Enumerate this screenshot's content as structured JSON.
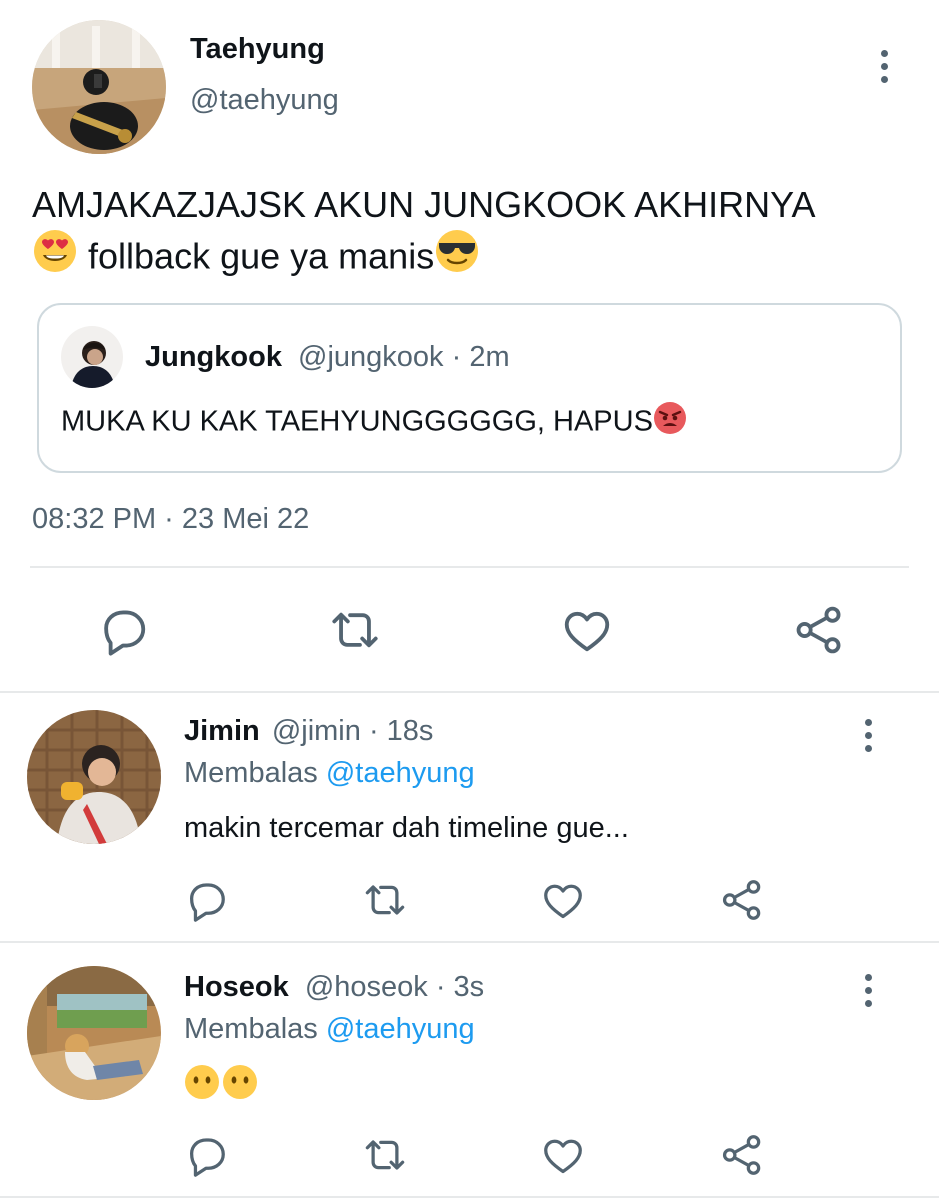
{
  "main_tweet": {
    "author_name": "Taehyung",
    "author_handle": "@taehyung",
    "text_line1": "AMJAKAZJAJSK AKUN JUNGKOOK AKHIRNYA",
    "text_line2": "follback gue ya manis",
    "emoji_1": "smiling-face-heart-eyes",
    "emoji_2": "smiling-face-sunglasses",
    "timestamp": "08:32 PM · 23 Mei 22",
    "quoted": {
      "author_name": "Jungkook",
      "author_handle": "@jungkook",
      "time": "· 2m",
      "text": "MUKA KU KAK TAEHYUNGGGGGG, HAPUS",
      "emoji": "angry-face"
    }
  },
  "replies": [
    {
      "author_name": "Jimin",
      "author_handle": "@jimin",
      "time": "· 18s",
      "replying_prefix": "Membalas",
      "replying_to": "@taehyung",
      "text": "makin tercemar dah timeline gue..."
    },
    {
      "author_name": "Hoseok",
      "author_handle": "@hoseok",
      "time": "· 3s",
      "replying_prefix": "Membalas",
      "replying_to": "@taehyung",
      "text": "",
      "emojis": [
        "neutral-face-no-mouth",
        "neutral-face-no-mouth"
      ]
    }
  ],
  "icons": [
    "reply-icon",
    "retweet-icon",
    "like-icon",
    "share-icon",
    "more-icon"
  ],
  "colors": {
    "text": "#0f1419",
    "secondary": "#536471",
    "link": "#1d9bf0",
    "divider": "#e7e9ea",
    "card_border": "#cfd9de"
  }
}
